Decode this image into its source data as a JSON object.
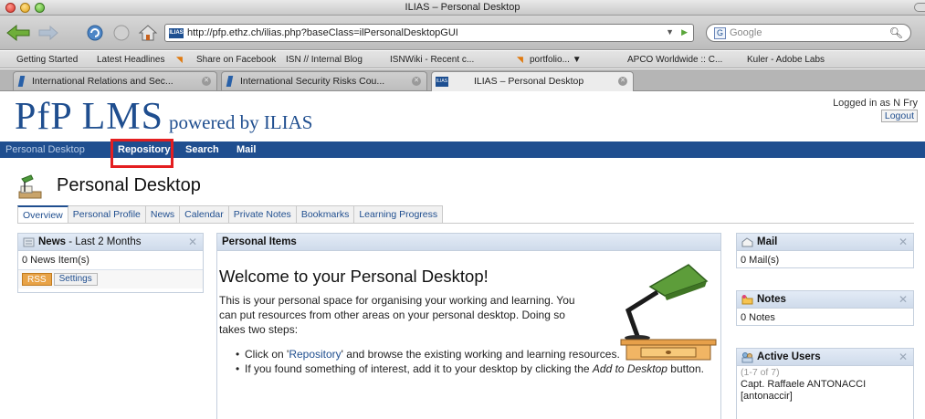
{
  "window": {
    "title": "ILIAS – Personal Desktop"
  },
  "browser": {
    "url": "http://pfp.ethz.ch/ilias.php?baseClass=ilPersonalDesktopGUI",
    "search_placeholder": "Google",
    "favicon_text": "ILIAS",
    "bookmarks": [
      "Getting Started",
      "Latest Headlines",
      "Share on Facebook",
      "ISN // Internal Blog",
      "ISNWiki - Recent c...",
      "portfolio... ▼",
      "APCO Worldwide :: C...",
      "Kuler - Adobe Labs"
    ],
    "tabs": [
      {
        "label": "International Relations and Sec..."
      },
      {
        "label": "International Security Risks Cou..."
      },
      {
        "label": "ILIAS – Personal Desktop"
      }
    ]
  },
  "brand": {
    "main": "PfP LMS",
    "sub": "powered by ILIAS"
  },
  "login": {
    "text": "Logged in as N Fry",
    "logout": "Logout"
  },
  "main_menu": [
    "Personal Desktop",
    "Repository",
    "Search",
    "Mail"
  ],
  "page": {
    "title": "Personal Desktop"
  },
  "subtabs": [
    "Overview",
    "Personal Profile",
    "News",
    "Calendar",
    "Private Notes",
    "Bookmarks",
    "Learning Progress"
  ],
  "news_block": {
    "title": "News",
    "range": " - Last 2 Months",
    "count": "0 News Item(s)",
    "rss": "RSS",
    "settings": "Settings"
  },
  "personal_items": {
    "title": "Personal Items",
    "welcome": "Welcome to your Personal Desktop!",
    "intro": "This is your personal space for organising your working and learning. You can put resources from other areas on your personal desktop. Doing so takes two steps:",
    "step1_pre": "Click on '",
    "step1_link": "Repository",
    "step1_post": "' and browse the existing working and learning resources.",
    "step2_pre": "If you found something of interest, add it to your desktop by clicking the ",
    "step2_em": "Add to Desktop",
    "step2_post": " button."
  },
  "mail_block": {
    "title": "Mail",
    "count": "0 Mail(s)"
  },
  "notes_block": {
    "title": "Notes",
    "count": "0 Notes"
  },
  "users_block": {
    "title": "Active Users",
    "range": "(1-7 of 7)",
    "user1": "Capt. Raffaele ANTONACCI",
    "user1_login": "[antonaccir]"
  },
  "colors": {
    "ilias_blue": "#1f4e8f",
    "highlight": "#e41e20"
  }
}
